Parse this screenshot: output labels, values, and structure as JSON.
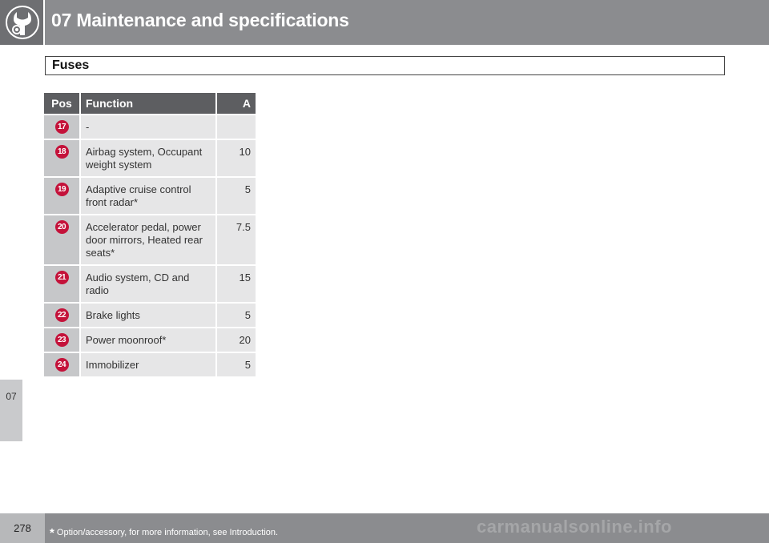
{
  "header": {
    "title": "07 Maintenance and specifications",
    "icon": "wrench-gear-icon"
  },
  "section": {
    "title": "Fuses"
  },
  "side_tab": {
    "label": "07"
  },
  "table": {
    "columns": [
      "Pos",
      "Function",
      "A"
    ],
    "rows": [
      {
        "pos": "17",
        "function": "-",
        "amps": ""
      },
      {
        "pos": "18",
        "function": "Airbag system, Occupant weight system",
        "amps": "10"
      },
      {
        "pos": "19",
        "function": "Adaptive cruise control front radar*",
        "amps": "5"
      },
      {
        "pos": "20",
        "function": "Accelerator pedal, power door mirrors, Heated rear seats*",
        "amps": "7.5"
      },
      {
        "pos": "21",
        "function": "Audio system, CD and radio",
        "amps": "15"
      },
      {
        "pos": "22",
        "function": "Brake lights",
        "amps": "5"
      },
      {
        "pos": "23",
        "function": "Power moonroof*",
        "amps": "20"
      },
      {
        "pos": "24",
        "function": "Immobilizer",
        "amps": "5"
      }
    ]
  },
  "footer": {
    "page_number": "278",
    "footnote_star": "*",
    "footnote": "Option/accessory, for more information, see Introduction."
  },
  "watermark": "carmanualsonline.info",
  "colors": {
    "header_bg": "#8b8c8f",
    "badge": "#c4123a",
    "table_header": "#5d5e61"
  }
}
